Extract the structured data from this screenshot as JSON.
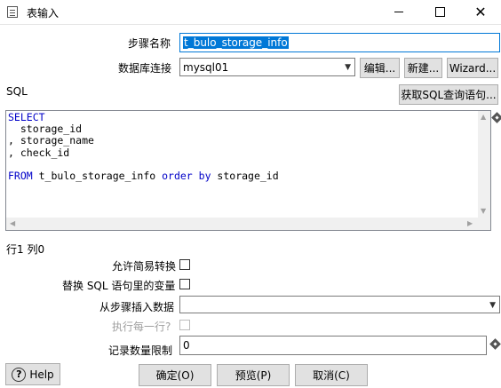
{
  "window": {
    "title": "表输入"
  },
  "form": {
    "step_name_label": "步骤名称",
    "step_name_value": "t_bulo_storage_info",
    "db_conn_label": "数据库连接",
    "db_conn_value": "mysql01",
    "edit_button": "编辑...",
    "new_button": "新建...",
    "wizard_button": "Wizard...",
    "sql_label": "SQL",
    "get_sql_button": "获取SQL查询语句..."
  },
  "sql": {
    "lines": [
      [
        {
          "t": "SELECT",
          "kw": true
        }
      ],
      [
        {
          "t": "  storage_id",
          "kw": false
        }
      ],
      [
        {
          "t": ", storage_name",
          "kw": false
        }
      ],
      [
        {
          "t": ", check_id",
          "kw": false
        }
      ],
      [
        {
          "t": "",
          "kw": false
        }
      ],
      [
        {
          "t": "FROM",
          "kw": true
        },
        {
          "t": " t_bulo_storage_info ",
          "kw": false
        },
        {
          "t": "order by",
          "kw": true
        },
        {
          "t": " storage_id",
          "kw": false
        }
      ]
    ]
  },
  "status": {
    "position": "行1 列0"
  },
  "options": {
    "lazy_conversion_label": "允许简易转换",
    "replace_vars_label": "替换 SQL 语句里的变量",
    "insert_from_step_label": "从步骤插入数据",
    "insert_from_step_value": "",
    "execute_each_row_label": "执行每一行?",
    "limit_label": "记录数量限制",
    "limit_value": "0"
  },
  "buttons": {
    "help": "Help",
    "ok": "确定(O)",
    "preview": "预览(P)",
    "cancel": "取消(C)"
  },
  "icons": {
    "window": "table-input-icon",
    "minimize": "minimize-icon",
    "maximize": "maximize-icon",
    "close": "close-icon",
    "help": "help-icon",
    "dropdown": "chevron-down-icon",
    "variable": "variable-diamond-icon"
  }
}
